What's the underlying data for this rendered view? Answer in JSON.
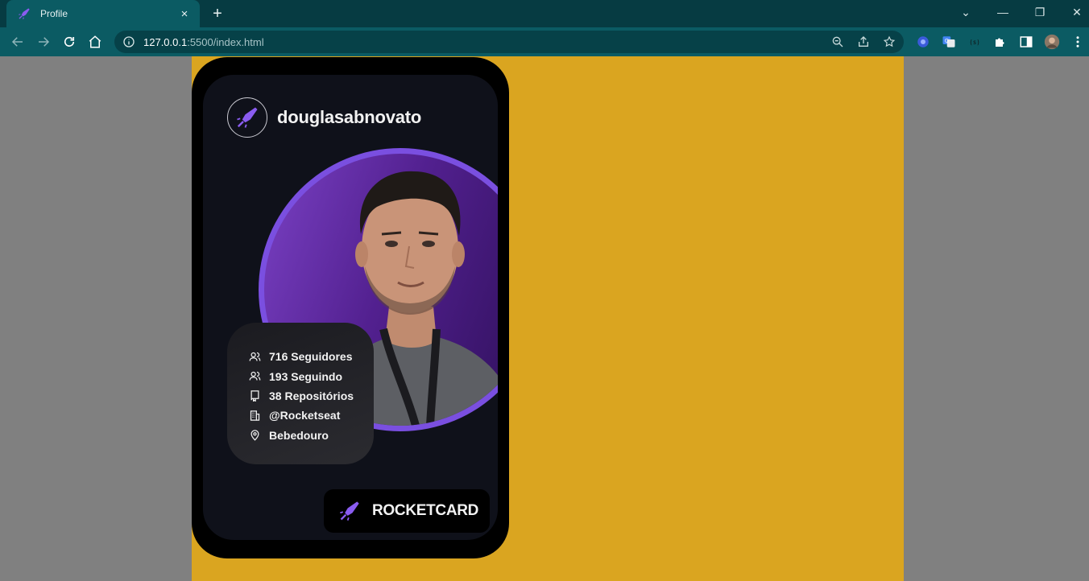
{
  "browser": {
    "tab_title": "Profile",
    "tab_close": "×",
    "new_tab": "+",
    "url_host": "127.0.0.1",
    "url_rest": ":5500/index.html",
    "window": {
      "dropdown": "⌄",
      "minimize": "—",
      "restore": "❐",
      "close": "✕"
    }
  },
  "profile": {
    "username": "douglasabnovato",
    "stats": [
      {
        "icon": "users-icon",
        "text": "716 Seguidores"
      },
      {
        "icon": "users-icon",
        "text": "193 Seguindo"
      },
      {
        "icon": "repo-icon",
        "text": "38 Repositórios"
      },
      {
        "icon": "building-icon",
        "text": "@Rocketseat"
      },
      {
        "icon": "map-pin-icon",
        "text": "Bebedouro"
      }
    ],
    "brand_label": "ROCKETCARD"
  },
  "colors": {
    "page_bg": "#daa520",
    "card_bg": "#0f111a",
    "accent": "#7a4fe0",
    "browser_frame": "#0b5b63"
  }
}
